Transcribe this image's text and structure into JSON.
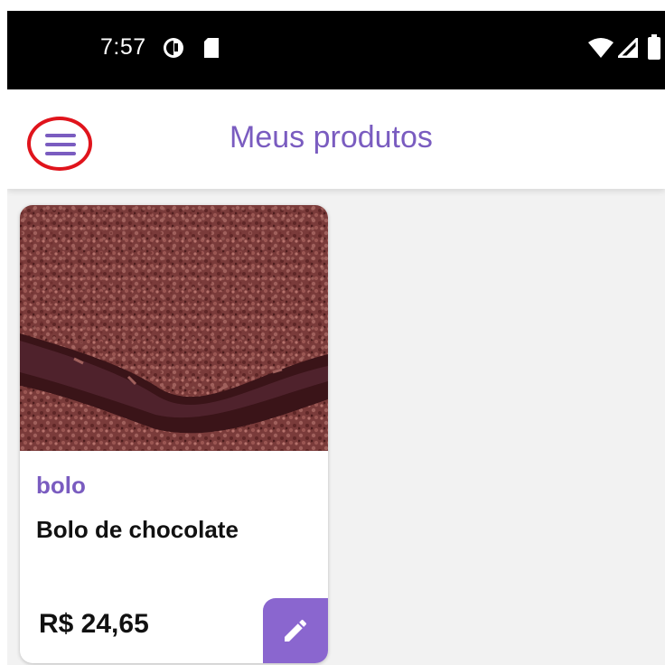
{
  "status_bar": {
    "time": "7:57",
    "left_icons": [
      "app-notification-icon",
      "sd-card-icon"
    ],
    "right_icons": [
      "wifi-icon",
      "cell-signal-icon",
      "battery-icon"
    ]
  },
  "app_bar": {
    "title": "Meus produtos",
    "menu_icon": "hamburger-menu-icon",
    "highlight_color": "#e0141c"
  },
  "products": [
    {
      "category": "bolo",
      "name": "Bolo de chocolate",
      "price": "R$ 24,65",
      "image": "chocolate-cake-photo",
      "action_icon": "pencil-edit-icon"
    }
  ],
  "colors": {
    "accent": "#7a5cc0",
    "button": "#8a66cf",
    "background": "#f2f2f2",
    "status_bar": "#000000"
  }
}
